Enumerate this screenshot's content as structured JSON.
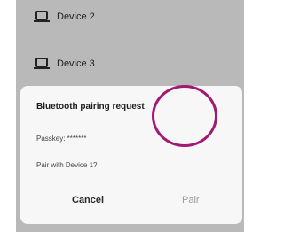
{
  "devices": [
    {
      "label": "Device 2",
      "icon": "laptop-icon"
    },
    {
      "label": "Device 3",
      "icon": "laptop-icon"
    }
  ],
  "dialog": {
    "title": "Bluetooth pairing request",
    "passkey": "Passkey: *******",
    "question": "Pair with Device 1?",
    "cancel_label": "Cancel",
    "pair_label": "Pair"
  },
  "colors": {
    "background": "#b9b9b9",
    "dialog_bg": "#f7f7f7",
    "highlight": "#a11a72",
    "pair_disabled_text": "#9a9a9a"
  }
}
